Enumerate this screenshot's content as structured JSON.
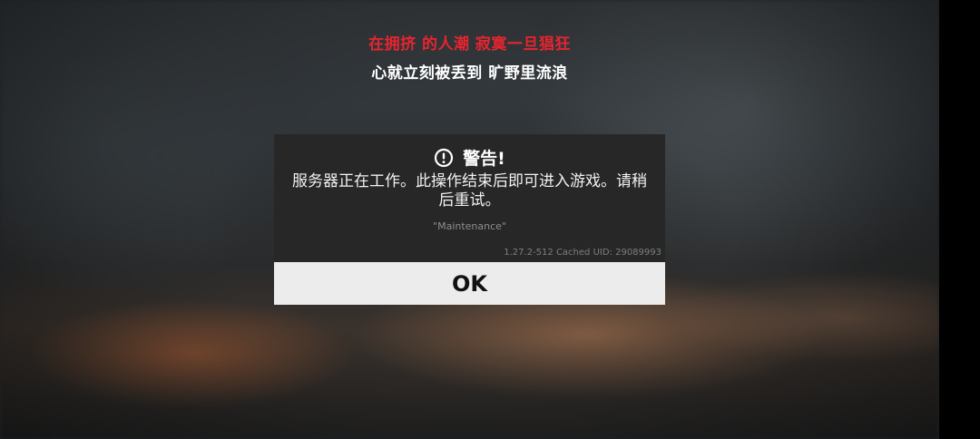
{
  "lyrics": {
    "line1": "在拥挤 的人潮 寂寞一旦猖狂",
    "line2": "心就立刻被丢到 旷野里流浪"
  },
  "dialog": {
    "icon": "exclamation-circle-icon",
    "title": "警告!",
    "message": "服务器正在工作。此操作结束后即可进入游戏。请稍后重试。",
    "detail": "\"Maintenance\"",
    "version": "1.27.2-512 Cached UID: 29089993",
    "ok_label": "OK"
  },
  "colors": {
    "lyric_highlight": "#e8242e",
    "dialog_bg": "#272727",
    "button_bg": "#ececec"
  }
}
